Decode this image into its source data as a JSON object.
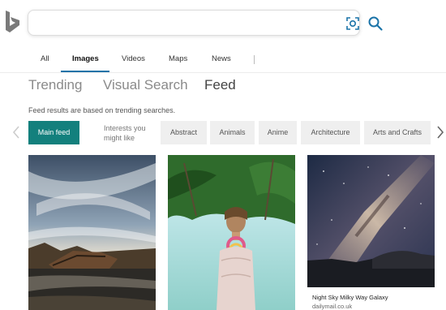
{
  "brand": {
    "logo_icon": "bing-logo-icon",
    "accent": "#13807d",
    "tab_accent": "#1a73a8"
  },
  "search": {
    "value": "",
    "placeholder": ""
  },
  "nav": {
    "tabs": [
      {
        "label": "All",
        "active": false
      },
      {
        "label": "Images",
        "active": true
      },
      {
        "label": "Videos",
        "active": false
      },
      {
        "label": "Maps",
        "active": false
      },
      {
        "label": "News",
        "active": false
      }
    ],
    "separator": "|"
  },
  "subtabs": [
    {
      "label": "Trending",
      "active": false
    },
    {
      "label": "Visual Search",
      "active": false
    },
    {
      "label": "Feed",
      "active": true
    }
  ],
  "feed_note": "Feed results are based on trending searches.",
  "filters": {
    "main_feed_label": "Main feed",
    "interests_label": "Interests you might like",
    "chips": [
      "Abstract",
      "Animals",
      "Anime",
      "Architecture",
      "Arts and Crafts"
    ]
  },
  "cards": [
    {
      "title": "",
      "source": "",
      "image": "shipwreck-landscape"
    },
    {
      "title": "",
      "source": "",
      "image": "beach-woman-portrait"
    },
    {
      "title": "Night Sky Milky Way Galaxy",
      "source": "dailymail.co.uk",
      "image": "milky-way-night-sky"
    }
  ]
}
